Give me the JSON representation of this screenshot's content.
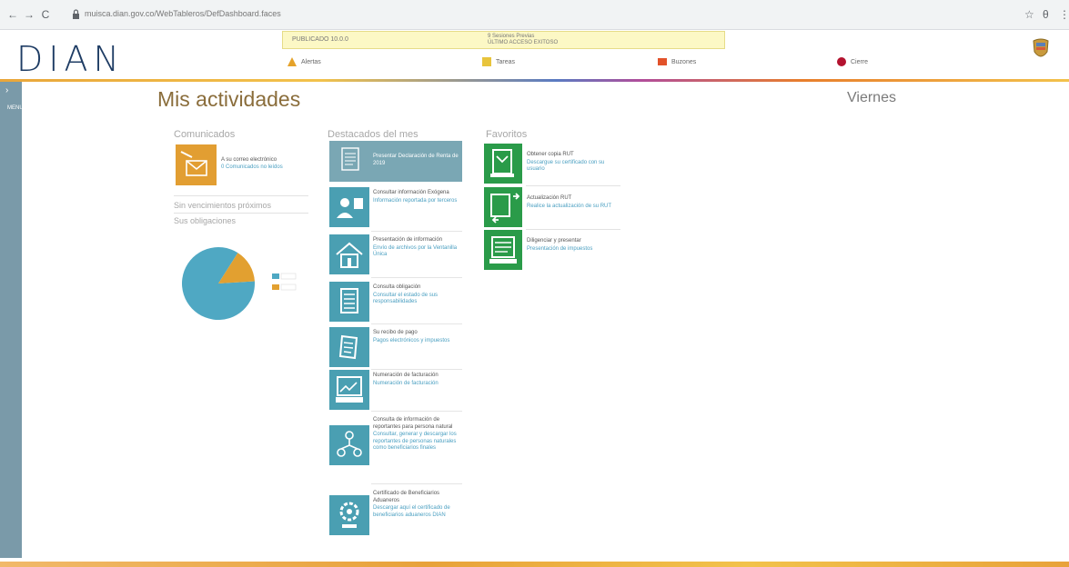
{
  "browser": {
    "back": "←",
    "forward": "→",
    "reload": "C",
    "url": "muisca.dian.gov.co/WebTableros/DefDashboard.faces",
    "star": "☆",
    "profile": "θ",
    "more": "⋮"
  },
  "header": {
    "logo": "DIAN",
    "notice_left": "PUBLICADO 10.0.0",
    "notice_mid_line1": "9 Sesiones Previas",
    "notice_mid_line2": "ÚLTIMO ACCESO EXITOSO",
    "items": [
      {
        "label": "Alertas",
        "icon": "warning-icon",
        "color": "#e5a22a"
      },
      {
        "label": "Tareas",
        "icon": "tasks-icon",
        "color": "#e8c43c"
      },
      {
        "label": "Buzones",
        "icon": "mailbox-icon",
        "color": "#e2522a"
      },
      {
        "label": "Cierre",
        "icon": "power-icon",
        "color": "#b3132f"
      }
    ]
  },
  "side_menu": {
    "arrow": "›",
    "label": "MENU"
  },
  "main": {
    "title": "Mis actividades",
    "day": "Viernes",
    "comunicados": {
      "title": "Comunicados",
      "item_title": "A su correo electrónico",
      "item_desc": "0 Comunicados no leídos"
    },
    "vencimientos": "Sin vencimientos próximos",
    "obligaciones": "Sus obligaciones"
  },
  "destacados": {
    "title": "Destacados del mes",
    "highlight": {
      "label": "Presentar Declaración de Renta de 2019"
    },
    "items": [
      {
        "title": "Consultar información Exógena",
        "desc": "Información reportada por terceros",
        "icon": "person-doc-icon"
      },
      {
        "title": "Presentación de información",
        "desc": "Envío de archivos por la Ventanilla Única",
        "icon": "house-icon"
      },
      {
        "title": "Consulta obligación",
        "desc": "Consultar el estado de sus responsabilidades",
        "icon": "document-icon"
      },
      {
        "title": "Su recibo de pago",
        "desc": "Pagos electrónicos y impuestos",
        "icon": "receipt-icon"
      },
      {
        "title": "Numeración de facturación",
        "desc": "Numeración de facturación",
        "icon": "invoice-icon"
      },
      {
        "title": "Consulta de información de reportantes para persona natural",
        "desc": "Consultar, generar y descargar los reportantes de personas naturales como beneficiarios finales",
        "icon": "network-icon"
      },
      {
        "title": "Certificado de Beneficiarios Aduaneros",
        "desc": "Descargar aquí el certificado de beneficiarios aduaneros DIAN",
        "icon": "gear-icon"
      }
    ]
  },
  "favoritos": {
    "title": "Favoritos",
    "items": [
      {
        "title": "Obtener copia RUT",
        "desc": "Descargue su certificado con su usuario",
        "icon": "rut-copy-icon"
      },
      {
        "title": "Actualización RUT",
        "desc": "Realice la actualización de su RUT",
        "icon": "rut-update-icon"
      },
      {
        "title": "Diligenciar y presentar",
        "desc": "Presentación de impuestos",
        "icon": "form-icon"
      }
    ]
  },
  "chart_data": {
    "type": "pie",
    "values": [
      85,
      15
    ],
    "colors": [
      "#4fa8c3",
      "#e2a030"
    ],
    "legend": [
      "",
      ""
    ],
    "title": ""
  }
}
